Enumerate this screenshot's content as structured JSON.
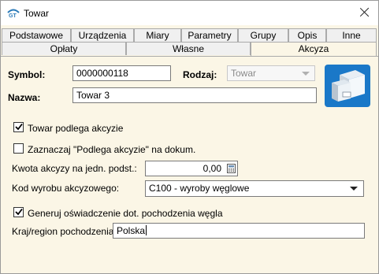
{
  "window": {
    "title": "Towar"
  },
  "icons": {
    "app": "app-logo-icon",
    "close": "close-icon",
    "calculator": "calculator-icon",
    "product": "product-box-icon"
  },
  "tabs_row1": [
    "Podstawowe",
    "Urządzenia",
    "Miary",
    "Parametry",
    "Grupy",
    "Opis",
    "Inne"
  ],
  "tabs_row2": [
    "Opłaty",
    "Własne",
    "Akcyza"
  ],
  "active_tab": "Akcyza",
  "form": {
    "symbol_label": "Symbol:",
    "symbol_value": "0000000118",
    "rodzaj_label": "Rodzaj:",
    "rodzaj_value": "Towar",
    "nazwa_label": "Nazwa:",
    "nazwa_value": "Towar 3",
    "podlega_label": "Towar podlega akcyzie",
    "podlega_checked": true,
    "zaznaczaj_label": "Zaznaczaj \"Podlega akcyzie\" na dokum.",
    "zaznaczaj_checked": false,
    "kwota_label": "Kwota akcyzy na jedn. podst.:",
    "kwota_value": "0,00",
    "kod_label": "Kod wyrobu akcyzowego:",
    "kod_value": "C100 - wyroby węglowe",
    "generuj_label": "Generuj oświadczenie dot. pochodzenia węgla",
    "generuj_checked": true,
    "kraj_label": "Kraj/region pochodzenia:",
    "kraj_value": "Polska"
  }
}
